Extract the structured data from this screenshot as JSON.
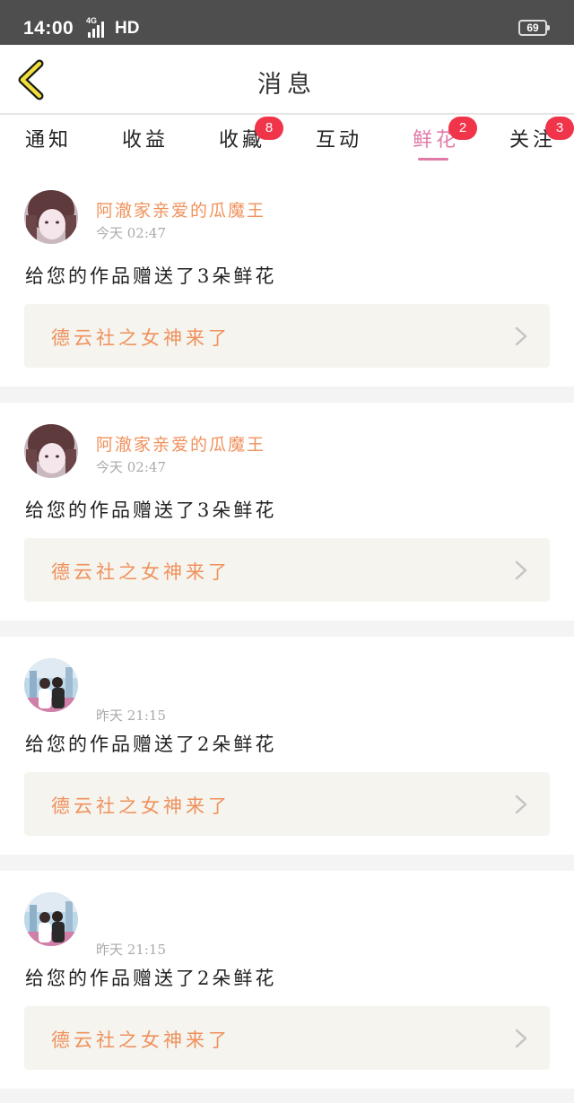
{
  "status_bar": {
    "time": "14:00",
    "network": "4G",
    "hd": "HD",
    "battery": "69"
  },
  "header": {
    "back_icon": "chevron-left-icon",
    "title": "消息"
  },
  "tabs": [
    {
      "label": "通知",
      "badge": "",
      "active": false
    },
    {
      "label": "收益",
      "badge": "",
      "active": false
    },
    {
      "label": "收藏",
      "badge": "8",
      "active": false
    },
    {
      "label": "互动",
      "badge": "",
      "active": false
    },
    {
      "label": "鲜花",
      "badge": "2",
      "active": true
    },
    {
      "label": "关注",
      "badge": "3",
      "active": false
    }
  ],
  "colors": {
    "accent_pink": "#e07aa7",
    "name_orange": "#f0915c",
    "badge_red": "#f0344a"
  },
  "messages": [
    {
      "user": "阿澈家亲爱的瓜魔王",
      "time": "今天 02:47",
      "text": "给您的作品赠送了3朵鲜花",
      "work": "德云社之女神来了"
    },
    {
      "user": "阿澈家亲爱的瓜魔王",
      "time": "今天 02:47",
      "text": "给您的作品赠送了3朵鲜花",
      "work": "德云社之女神来了"
    },
    {
      "user": "",
      "time": "昨天 21:15",
      "text": "给您的作品赠送了2朵鲜花",
      "work": "德云社之女神来了"
    },
    {
      "user": "",
      "time": "昨天 21:15",
      "text": "给您的作品赠送了2朵鲜花",
      "work": "德云社之女神来了"
    }
  ]
}
